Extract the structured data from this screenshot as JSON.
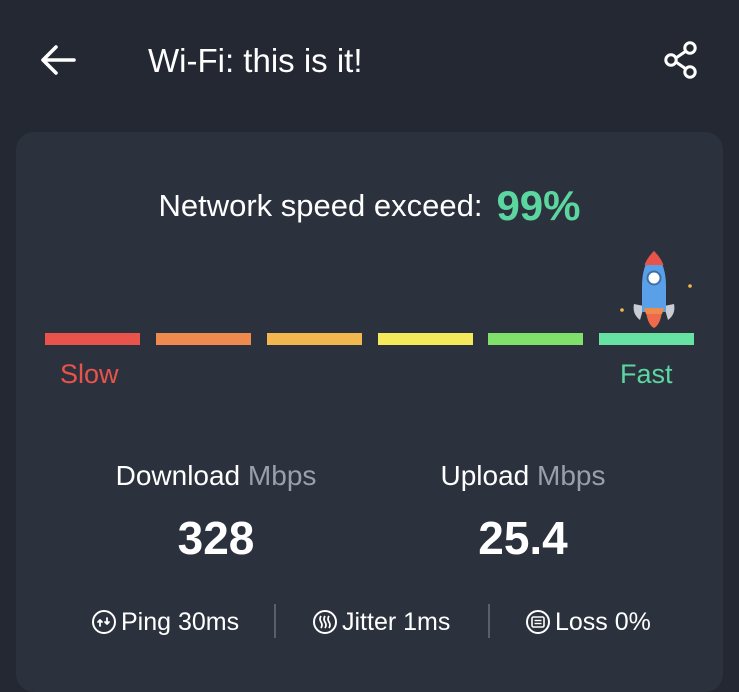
{
  "header": {
    "title": "Wi-Fi: this is it!",
    "back_icon": "back-arrow-icon",
    "share_icon": "share-icon"
  },
  "result": {
    "exceed_label": "Network speed exceed:",
    "exceed_value": "99%",
    "exceed_color": "#5cd6a0"
  },
  "scale": {
    "slow_label": "Slow",
    "fast_label": "Fast",
    "segment_colors": [
      "#e8534b",
      "#ef8a4f",
      "#f2b84f",
      "#f3e95a",
      "#7fe06a",
      "#66e3a3"
    ],
    "slow_color": "#e8534b",
    "fast_color": "#5cd6a0",
    "indicator_icon": "rocket-icon"
  },
  "metrics": {
    "download": {
      "label": "Download",
      "unit": "Mbps",
      "value": "328"
    },
    "upload": {
      "label": "Upload",
      "unit": "Mbps",
      "value": "25.4"
    }
  },
  "stats": {
    "ping": {
      "icon": "ping-icon",
      "label": "Ping 30ms"
    },
    "jitter": {
      "icon": "jitter-icon",
      "label": "Jitter 1ms"
    },
    "loss": {
      "icon": "loss-icon",
      "label": "Loss 0%"
    }
  }
}
